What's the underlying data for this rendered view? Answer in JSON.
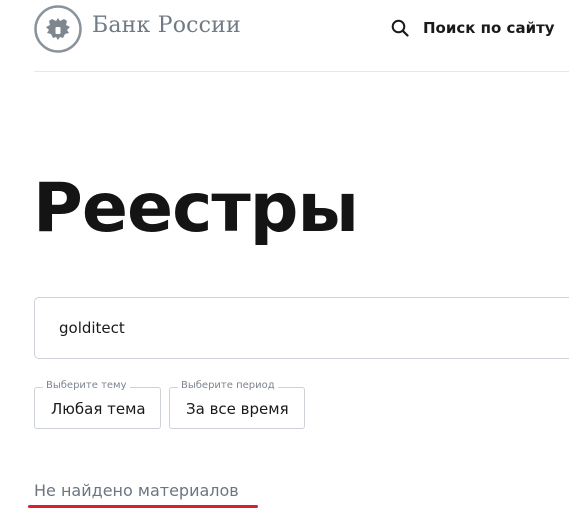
{
  "header": {
    "brand": "Банк России",
    "search_label": "Поиск по сайту",
    "icons": {
      "logo": "bank-emblem-icon",
      "search": "search-icon"
    }
  },
  "page": {
    "title": "Реестры"
  },
  "search": {
    "value": "golditect"
  },
  "filters": {
    "topic": {
      "legend": "Выберите тему",
      "value": "Любая тема"
    },
    "period": {
      "legend": "Выберите период",
      "value": "За все время"
    }
  },
  "results": {
    "empty_message": "Не найдено материалов"
  },
  "colors": {
    "brand_text": "#707a85",
    "annotation_underline": "#d9202f",
    "border": "#cdd2d8"
  }
}
